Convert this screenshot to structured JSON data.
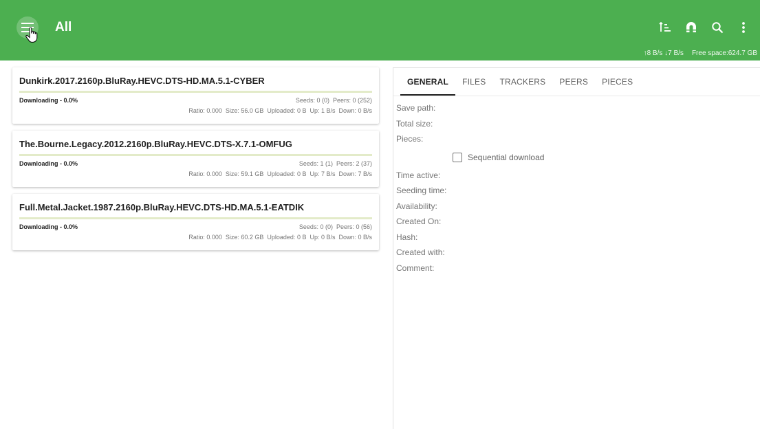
{
  "appbar": {
    "title": "All",
    "menu_icon": "hamburger-menu-icon",
    "actions": [
      {
        "icon": "sort-icon",
        "name": "sort-button"
      },
      {
        "icon": "magnet-icon",
        "name": "add-magnet-button"
      },
      {
        "icon": "search-icon",
        "name": "search-button"
      },
      {
        "icon": "more-vert-icon",
        "name": "overflow-menu-button"
      }
    ],
    "speed": "↑8 B/s ↓7 B/s",
    "free_space": "Free space:624.7 GB"
  },
  "colors": {
    "primary": "#4caf50",
    "progress_track": "#e3ebc9",
    "progress_fill": "#8bc34a"
  },
  "torrents": [
    {
      "name": "Dunkirk.2017.2160p.BluRay.HEVC.DTS-HD.MA.5.1-CYBER",
      "status": "Downloading - 0.0%",
      "progress": 0.0,
      "seeds": "Seeds: 0 (0)",
      "peers": "Peers: 0 (252)",
      "ratio": "Ratio: 0.000",
      "size": "Size: 56.0 GB",
      "uploaded": "Uploaded: 0 B",
      "up": "Up: 1 B/s",
      "down": "Down: 0 B/s"
    },
    {
      "name": "The.Bourne.Legacy.2012.2160p.BluRay.HEVC.DTS-X.7.1-OMFUG",
      "status": "Downloading - 0.0%",
      "progress": 0.0,
      "seeds": "Seeds: 1 (1)",
      "peers": "Peers: 2 (37)",
      "ratio": "Ratio: 0.000",
      "size": "Size: 59.1 GB",
      "uploaded": "Uploaded: 0 B",
      "up": "Up: 7 B/s",
      "down": "Down: 7 B/s"
    },
    {
      "name": "Full.Metal.Jacket.1987.2160p.BluRay.HEVC.DTS-HD.MA.5.1-EATDIK",
      "status": "Downloading - 0.0%",
      "progress": 0.0,
      "seeds": "Seeds: 0 (0)",
      "peers": "Peers: 0 (56)",
      "ratio": "Ratio: 0.000",
      "size": "Size: 60.2 GB",
      "uploaded": "Uploaded: 0 B",
      "up": "Up: 0 B/s",
      "down": "Down: 0 B/s"
    }
  ],
  "detail": {
    "tabs": [
      "GENERAL",
      "FILES",
      "TRACKERS",
      "PEERS",
      "PIECES"
    ],
    "active_tab": "GENERAL",
    "fields_top": [
      "Save path:",
      "Total size:",
      "Pieces:"
    ],
    "sequential_label": "Sequential download",
    "sequential_checked": false,
    "fields_bottom": [
      "Time active:",
      "Seeding time:",
      "Availability:",
      "Created On:",
      "Hash:",
      "Created with:",
      "Comment:"
    ]
  }
}
